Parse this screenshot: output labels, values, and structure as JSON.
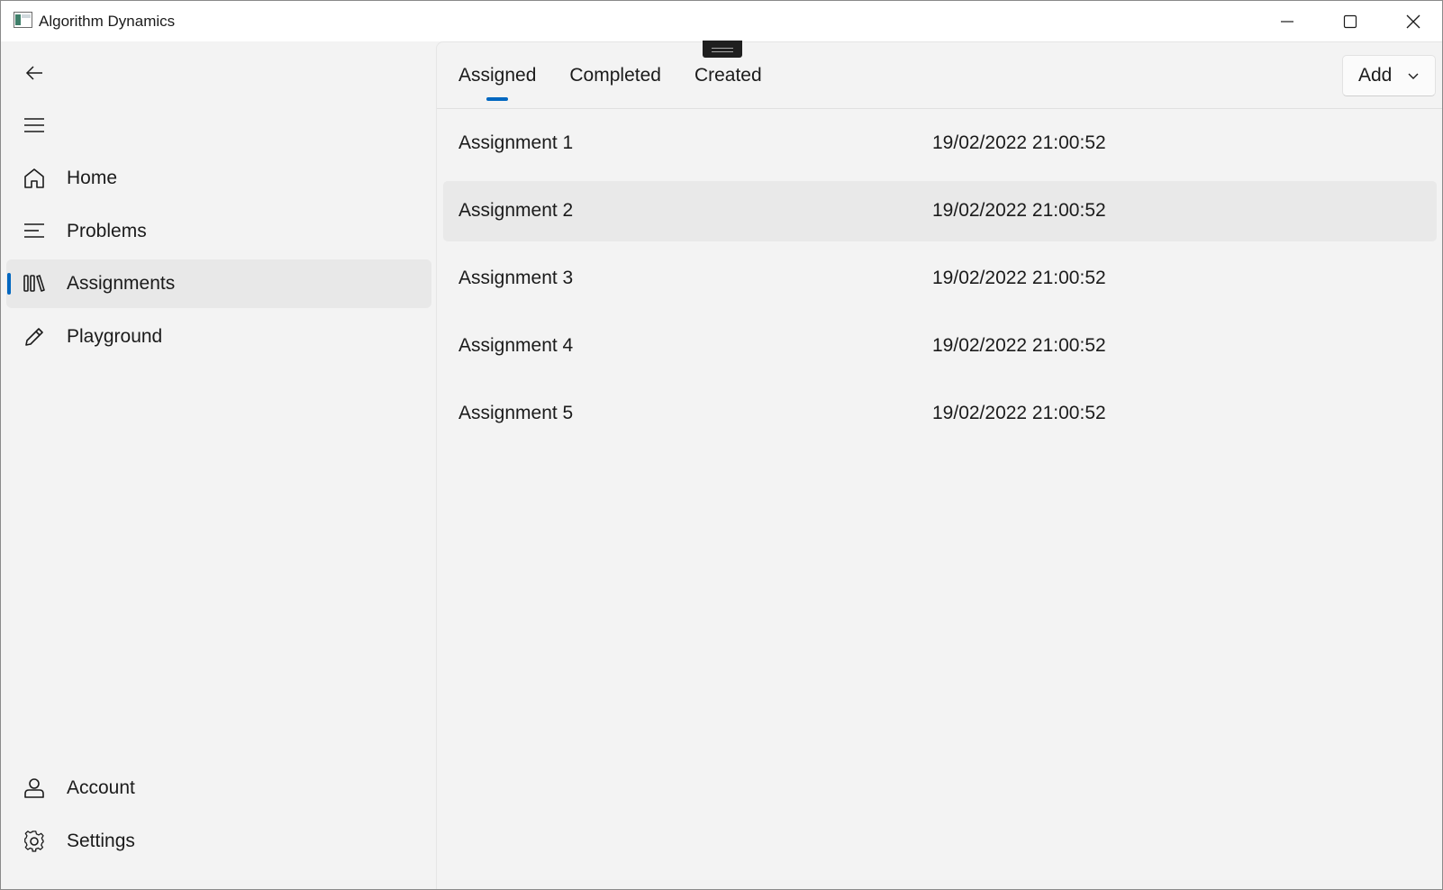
{
  "window": {
    "title": "Algorithm Dynamics"
  },
  "nav": {
    "items": [
      {
        "label": "Home",
        "icon": "home-icon"
      },
      {
        "label": "Problems",
        "icon": "list-icon"
      },
      {
        "label": "Assignments",
        "icon": "library-icon",
        "selected": true
      },
      {
        "label": "Playground",
        "icon": "pencil-icon"
      }
    ],
    "footer_items": [
      {
        "label": "Account",
        "icon": "person-icon"
      },
      {
        "label": "Settings",
        "icon": "gear-icon"
      }
    ]
  },
  "tabs": [
    {
      "label": "Assigned",
      "selected": true
    },
    {
      "label": "Completed"
    },
    {
      "label": "Created"
    }
  ],
  "add_button": {
    "label": "Add"
  },
  "assignments": [
    {
      "name": "Assignment 1",
      "date": "19/02/2022 21:00:52"
    },
    {
      "name": "Assignment 2",
      "date": "19/02/2022 21:00:52"
    },
    {
      "name": "Assignment 3",
      "date": "19/02/2022 21:00:52"
    },
    {
      "name": "Assignment 4",
      "date": "19/02/2022 21:00:52"
    },
    {
      "name": "Assignment 5",
      "date": "19/02/2022 21:00:52"
    }
  ],
  "colors": {
    "accent": "#0067c0",
    "background": "#f3f3f3",
    "selected_item": "#e8e8e8"
  }
}
